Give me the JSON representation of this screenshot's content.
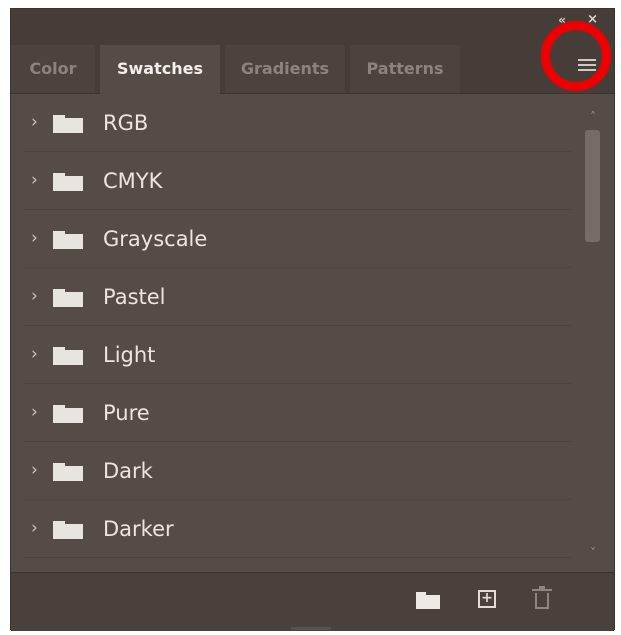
{
  "panel": {
    "title_buttons": {
      "collapse_icon": "double-chevron-left-icon",
      "close_icon": "close-icon"
    },
    "tabs": [
      {
        "label": "Color",
        "active": false
      },
      {
        "label": "Swatches",
        "active": true
      },
      {
        "label": "Gradients",
        "active": false
      },
      {
        "label": "Patterns",
        "active": false
      }
    ],
    "menu_icon": "hamburger-menu-icon",
    "swatch_groups": [
      {
        "label": "RGB"
      },
      {
        "label": "CMYK"
      },
      {
        "label": "Grayscale"
      },
      {
        "label": "Pastel"
      },
      {
        "label": "Light"
      },
      {
        "label": "Pure"
      },
      {
        "label": "Dark"
      },
      {
        "label": "Darker"
      }
    ],
    "footer": {
      "new_group_icon": "folder-icon",
      "new_swatch_icon": "plus-square-icon",
      "delete_icon": "trash-icon"
    }
  },
  "annotation": {
    "highlight_color": "#ef0000",
    "target": "panel-menu"
  },
  "colors": {
    "panel_bg": "#4a413d",
    "list_bg": "#554b47",
    "active_tab_text": "#f2efec",
    "inactive_tab_text": "#8d837e"
  }
}
